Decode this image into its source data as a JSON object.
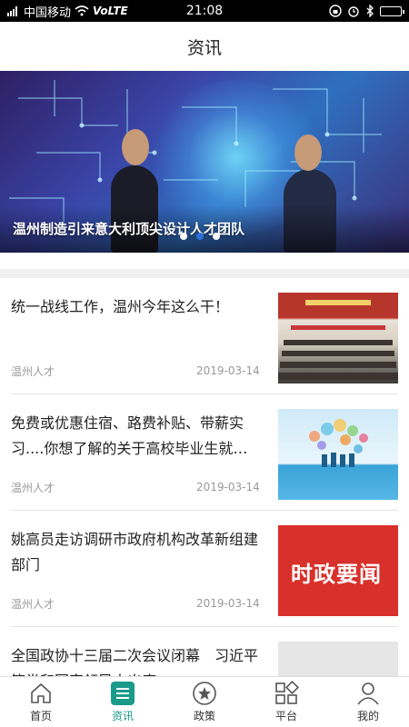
{
  "status_bar": {
    "carrier": "中国移动",
    "network": "VoLTE",
    "time": "21:08",
    "signal_prefix": "4G"
  },
  "header": {
    "title": "资讯"
  },
  "banner": {
    "caption": "温州制造引来意大利顶尖设计人才团队",
    "slides_total": 3,
    "active_slide": 2
  },
  "news": [
    {
      "title": "统一战线工作，温州今年这么干！",
      "source": "温州人才",
      "date": "2019-03-14"
    },
    {
      "title": "免费或优惠住宿、路费补贴、带薪实习....你想了解的关于高校毕业生就…",
      "source": "温州人才",
      "date": "2019-03-14"
    },
    {
      "title": "姚高员走访调研市政府机构改革新组建部门",
      "source": "温州人才",
      "date": "2019-03-14",
      "thumb_text": "时政要闻"
    },
    {
      "title": "全国政协十三届二次会议闭幕　习近平等党和国家领导人出席",
      "source": "",
      "date": ""
    }
  ],
  "tabs": [
    {
      "label": "首页",
      "icon": "home-icon"
    },
    {
      "label": "资讯",
      "icon": "news-icon",
      "active": true
    },
    {
      "label": "政策",
      "icon": "policy-star-icon"
    },
    {
      "label": "平台",
      "icon": "platform-grid-icon"
    },
    {
      "label": "我的",
      "icon": "profile-icon"
    }
  ],
  "colors": {
    "accent": "#1a9a8a",
    "banner_dot_active": "#2b6fd6"
  }
}
